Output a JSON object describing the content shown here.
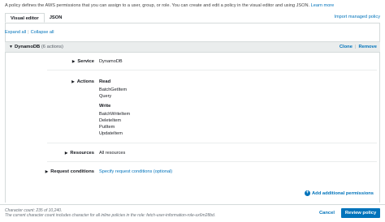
{
  "intro": {
    "text": "A policy defines the AWS permissions that you can assign to a user, group, or role. You can create and edit a policy in the visual editor and using JSON.",
    "learn_more": "Learn more"
  },
  "tabs": [
    {
      "label": "Visual editor",
      "active": true
    },
    {
      "label": "JSON",
      "active": false
    }
  ],
  "import_link": "Import managed policy",
  "toolbar": {
    "expand_all": "Expand all",
    "separator": "|",
    "collapse_all": "Collapse all"
  },
  "service_block": {
    "name": "DynamoDB",
    "count": "(6 actions)",
    "clone": "Clone",
    "separator": "|",
    "remove": "Remove"
  },
  "rows": {
    "service_label": "Service",
    "service_value": "DynamoDB",
    "actions_label": "Actions",
    "resources_label": "Resources",
    "resources_value": "All resources",
    "request_conditions_label": "Request conditions",
    "request_conditions_value": "Specify request conditions (optional)"
  },
  "action_groups": [
    {
      "title": "Read",
      "items": [
        "BatchGetItem",
        "Query"
      ]
    },
    {
      "title": "Write",
      "items": [
        "BatchWriteItem",
        "DeleteItem",
        "PutItem",
        "UpdateItem"
      ]
    }
  ],
  "add_permissions": "Add additional permissions",
  "footer": {
    "character_count": "Character count: 235 of 10,240.",
    "character_note": "The current character count includes character for all inline policies in the role: fetch-user-information-role-ux6m28bd.",
    "cancel": "Cancel",
    "review": "Review policy"
  },
  "colors": {
    "link": "#0073bb",
    "header_bg": "#eaeded",
    "primary_button": "#0073bb"
  }
}
